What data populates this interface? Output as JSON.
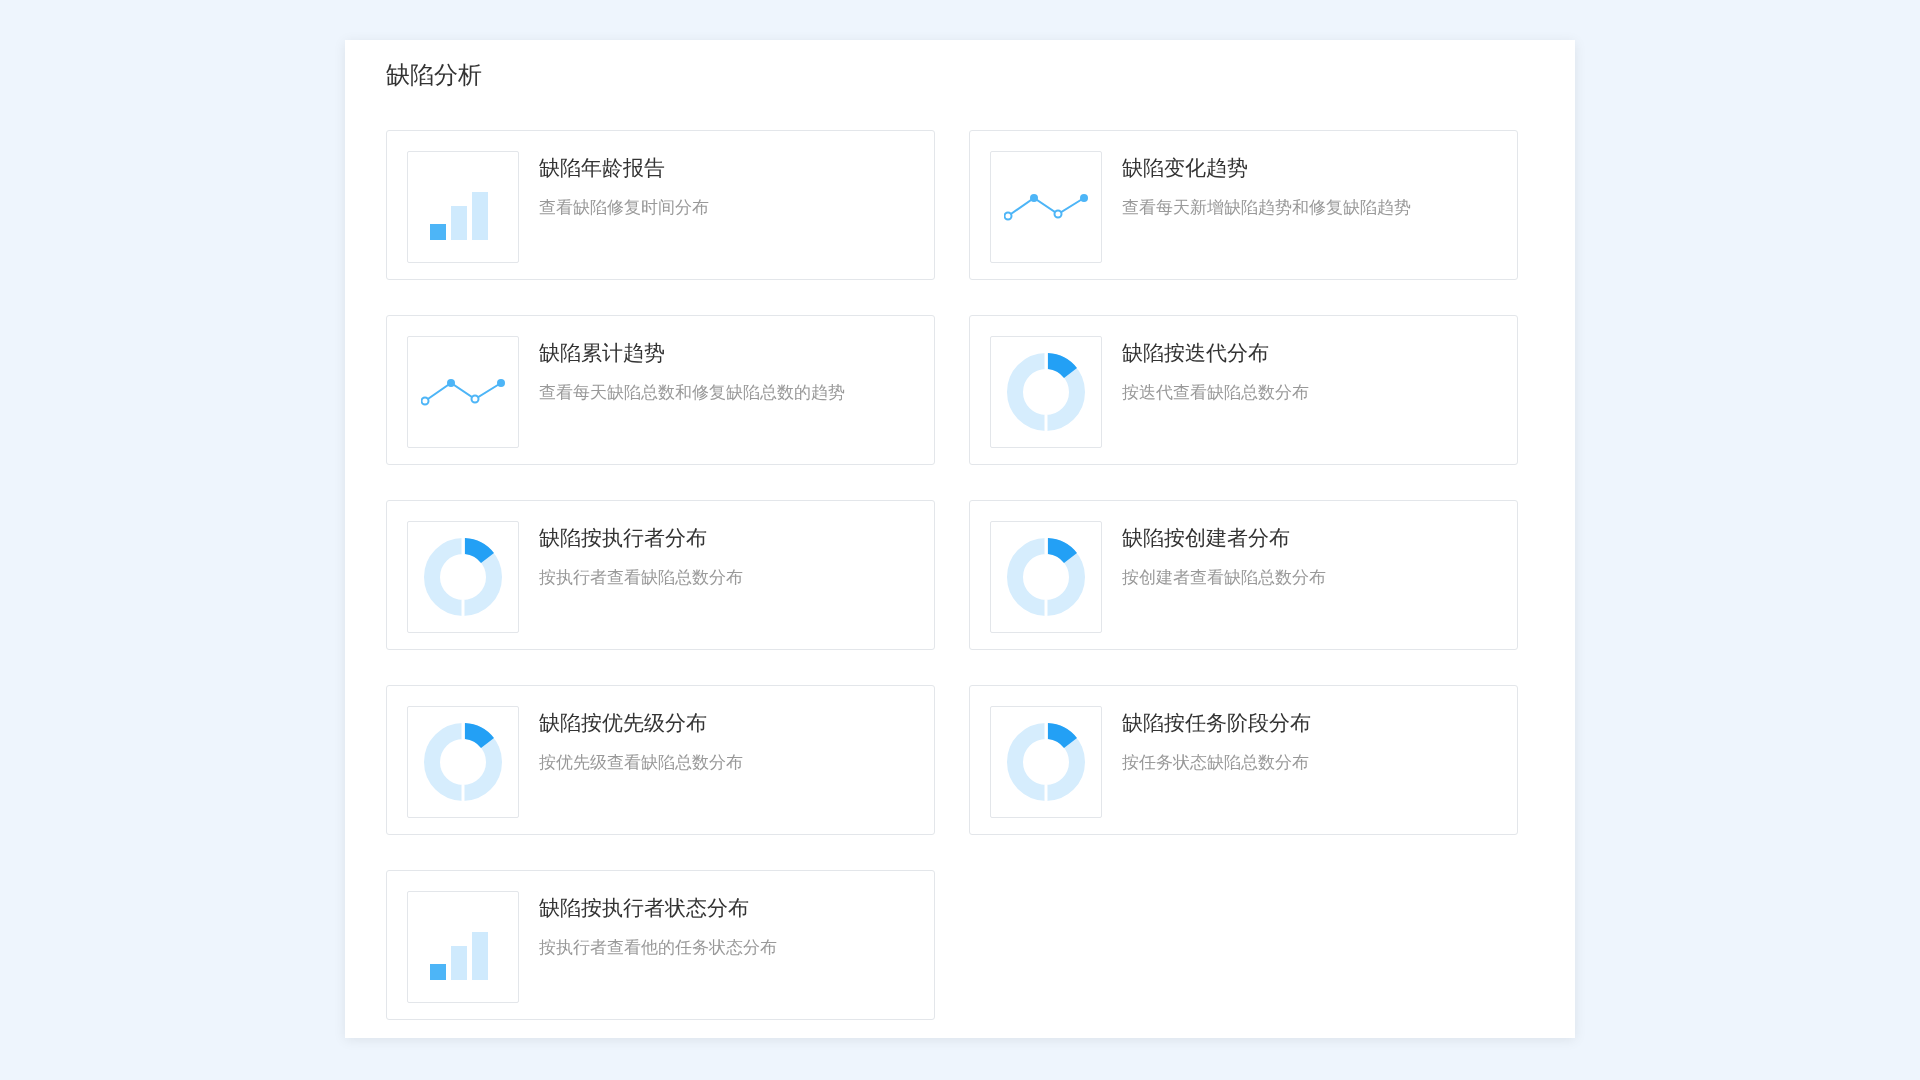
{
  "section": {
    "title": "缺陷分析"
  },
  "cards": [
    {
      "kind": "bar",
      "title": "缺陷年龄报告",
      "description": "查看缺陷修复时间分布"
    },
    {
      "kind": "line",
      "title": "缺陷变化趋势",
      "description": "查看每天新增缺陷趋势和修复缺陷趋势"
    },
    {
      "kind": "line",
      "title": "缺陷累计趋势",
      "description": "查看每天缺陷总数和修复缺陷总数的趋势"
    },
    {
      "kind": "donut",
      "title": "缺陷按迭代分布",
      "description": "按迭代查看缺陷总数分布"
    },
    {
      "kind": "donut",
      "title": "缺陷按执行者分布",
      "description": "按执行者查看缺陷总数分布"
    },
    {
      "kind": "donut",
      "title": "缺陷按创建者分布",
      "description": "按创建者查看缺陷总数分布"
    },
    {
      "kind": "donut",
      "title": "缺陷按优先级分布",
      "description": "按优先级查看缺陷总数分布"
    },
    {
      "kind": "donut",
      "title": "缺陷按任务阶段分布",
      "description": "按任务状态缺陷总数分布"
    },
    {
      "kind": "bar",
      "title": "缺陷按执行者状态分布",
      "description": "按执行者查看他的任务状态分布"
    }
  ]
}
